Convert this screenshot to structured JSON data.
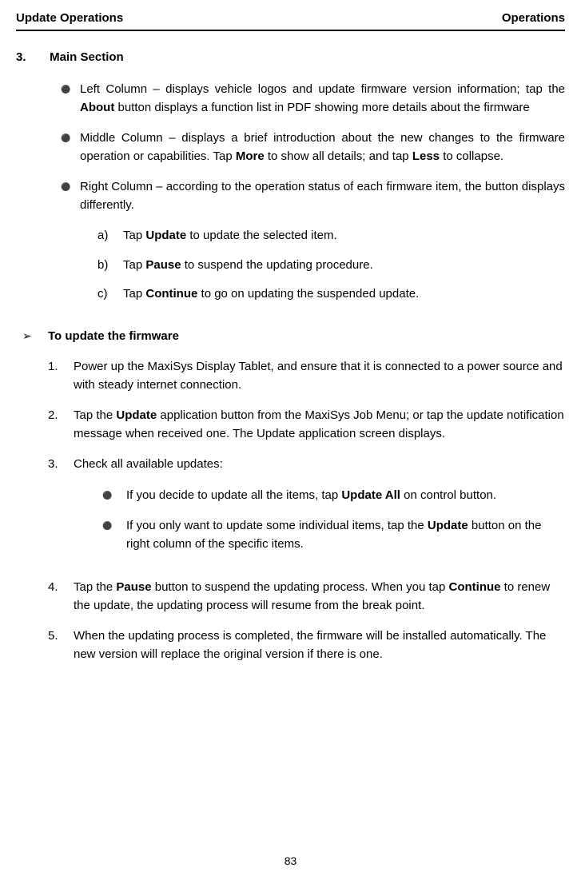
{
  "header": {
    "left": "Update Operations",
    "right": "Operations"
  },
  "section": {
    "number": "3.",
    "title": "Main Section"
  },
  "bullets": [
    {
      "pre": "Left Column – displays vehicle logos and update firmware version information; tap the ",
      "bold": "About",
      "post": " button displays a function list in PDF showing more details about the firmware"
    },
    {
      "pre": "Middle Column – displays a brief introduction about the new changes to the firmware operation or capabilities. Tap ",
      "bold": "More",
      "mid": " to show all details; and tap ",
      "bold2": "Less",
      "post": " to collapse."
    },
    {
      "pre": "Right Column – according to the operation status of each firmware item, the button displays differently.",
      "sub": [
        {
          "marker": "a)",
          "pre": "Tap ",
          "bold": "Update",
          "post": " to update the selected item."
        },
        {
          "marker": "b)",
          "pre": "Tap ",
          "bold": "Pause",
          "post": " to suspend the updating procedure."
        },
        {
          "marker": "c)",
          "pre": "Tap ",
          "bold": "Continue",
          "post": " to go on updating the suspended update."
        }
      ]
    }
  ],
  "arrow": {
    "label": "To update the firmware"
  },
  "steps": [
    {
      "num": "1.",
      "text": "Power up the MaxiSys Display Tablet, and ensure that it is connected to a power source and with steady internet connection."
    },
    {
      "num": "2.",
      "pre": "Tap the ",
      "bold": "Update",
      "post": " application button from the MaxiSys Job Menu; or tap the update notification message when received one. The Update application screen displays."
    },
    {
      "num": "3.",
      "text": "Check all available updates:",
      "nested": [
        {
          "pre": "If you decide to update all the items, tap ",
          "bold": "Update All",
          "post": " on control button."
        },
        {
          "pre": "If you only want to update some individual items, tap the ",
          "bold": "Update",
          "post": " button on the right column of the specific items."
        }
      ]
    },
    {
      "num": "4.",
      "pre": "Tap the ",
      "bold": "Pause",
      "mid": " button to suspend the updating process. When you tap ",
      "bold2": "Continue",
      "post": " to renew the update, the updating process will resume from the break point."
    },
    {
      "num": "5.",
      "text": "When the updating process is completed, the firmware will be installed automatically. The new version will replace the original version if there is one."
    }
  ],
  "page_number": "83"
}
